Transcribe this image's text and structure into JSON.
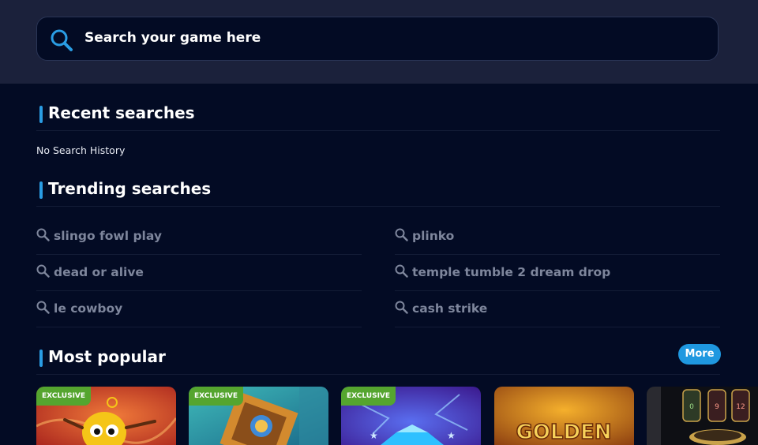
{
  "search": {
    "placeholder": "Search your game here"
  },
  "recent": {
    "title": "Recent searches",
    "empty": "No Search History"
  },
  "trending": {
    "title": "Trending searches",
    "items": [
      "slingo fowl play",
      "plinko",
      "dead or alive",
      "temple tumble 2 dream drop",
      "le cowboy",
      "cash strike"
    ]
  },
  "popular": {
    "title": "Most popular",
    "more_label": "More",
    "tiles": [
      {
        "badge": "EXCLUSIVE"
      },
      {
        "badge": "EXCLUSIVE"
      },
      {
        "badge": "EXCLUSIVE"
      },
      {
        "badge": "",
        "art_text": "GOLDEN"
      },
      {
        "badge": "",
        "reels": [
          "0",
          "9",
          "12"
        ]
      }
    ]
  },
  "colors": {
    "accent": "#2a9de4",
    "background": "#030b24",
    "header": "#1b213b",
    "badge": "#55a52f"
  }
}
